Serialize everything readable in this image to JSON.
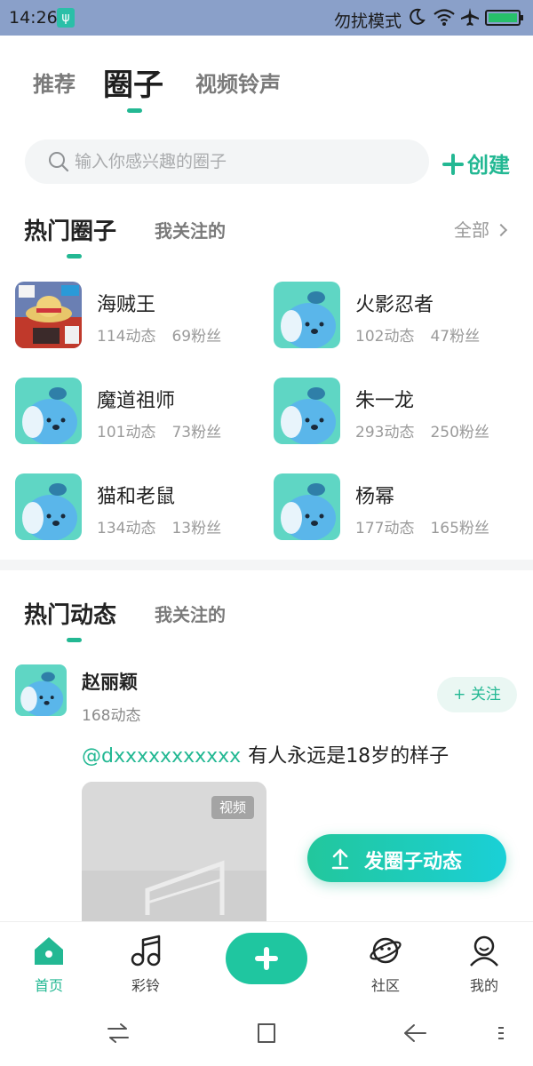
{
  "status_bar": {
    "time": "14:26",
    "mode": "勿扰模式"
  },
  "top_tabs": [
    {
      "label": "推荐",
      "active": false
    },
    {
      "label": "圈子",
      "active": true
    },
    {
      "label": "视频铃声",
      "active": false
    }
  ],
  "search": {
    "placeholder": "输入你感兴趣的圈子"
  },
  "create_label": "创建",
  "hot_circles": {
    "title": "热门圈子",
    "sub": "我关注的",
    "all_label": "全部",
    "items": [
      {
        "name": "海贼王",
        "posts": "114动态",
        "fans": "69粉丝"
      },
      {
        "name": "火影忍者",
        "posts": "102动态",
        "fans": "47粉丝"
      },
      {
        "name": "魔道祖师",
        "posts": "101动态",
        "fans": "73粉丝"
      },
      {
        "name": "朱一龙",
        "posts": "293动态",
        "fans": "250粉丝"
      },
      {
        "name": "猫和老鼠",
        "posts": "134动态",
        "fans": "13粉丝"
      },
      {
        "name": "杨幂",
        "posts": "177动态",
        "fans": "165粉丝"
      }
    ]
  },
  "hot_posts": {
    "title": "热门动态",
    "sub": "我关注的"
  },
  "post": {
    "user": "赵丽颖",
    "count": "168动态",
    "follow_label": "+ 关注",
    "mention": "@dxxxxxxxxxxx",
    "text": "有人永远是18岁的样子",
    "media_badge": "视频"
  },
  "fab_label": "发圈子动态",
  "bottom_nav": [
    {
      "label": "首页",
      "active": true
    },
    {
      "label": "彩铃",
      "active": false
    },
    {
      "label": "社区",
      "active": false
    },
    {
      "label": "我的",
      "active": false
    }
  ],
  "colors": {
    "accent": "#23b893",
    "status_bar": "#8aa0c9"
  }
}
